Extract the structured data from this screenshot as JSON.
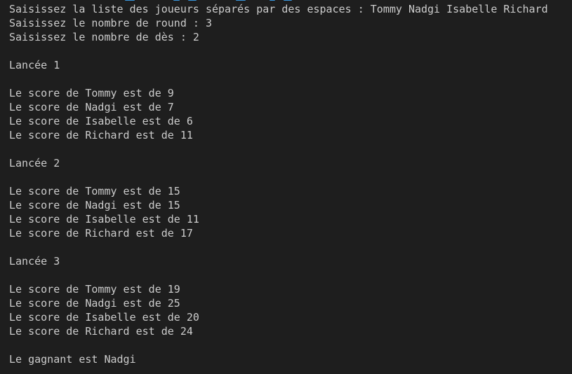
{
  "prompts": {
    "players_prompt": "Saisissez la liste des joueurs séparés par des espaces : Tommy Nadgi Isabelle Richard",
    "rounds_prompt": "Saisissez le nombre de round : 3",
    "dice_prompt": "Saisissez le nombre de dès : 2"
  },
  "rounds": [
    {
      "heading": "Lancée 1",
      "scores": [
        "Le score de Tommy est de 9",
        "Le score de Nadgi est de 7",
        "Le score de Isabelle est de 6",
        "Le score de Richard est de 11"
      ]
    },
    {
      "heading": "Lancée 2",
      "scores": [
        "Le score de Tommy est de 15",
        "Le score de Nadgi est de 15",
        "Le score de Isabelle est de 11",
        "Le score de Richard est de 17"
      ]
    },
    {
      "heading": "Lancée 3",
      "scores": [
        "Le score de Tommy est de 19",
        "Le score de Nadgi est de 25",
        "Le score de Isabelle est de 20",
        "Le score de Richard est de 24"
      ]
    }
  ],
  "winner": "Le gagnant est Nadgi",
  "colors": {
    "background": "#1e1e1e",
    "text": "#cccccc",
    "accent": "#3a96dd"
  }
}
